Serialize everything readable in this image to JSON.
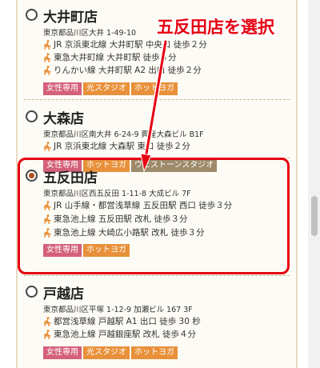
{
  "stores": [
    {
      "name": "大井町店",
      "address": "東京都品川区大井 1-49-10",
      "selected": false,
      "access": [
        "JR 京浜東北線 大井町駅 中央口 徒歩２分",
        "東急大井町線 大井町駅 徒歩４分",
        "りんかい線 大井町駅 A2 出口 徒歩２分"
      ],
      "tags": [
        {
          "label": "女性専用",
          "color": "pink"
        },
        {
          "label": "光スタジオ",
          "color": "orange"
        },
        {
          "label": "ホットヨガ",
          "color": "orange"
        }
      ]
    },
    {
      "name": "大森店",
      "address": "東京都品川区南大井 6-24-9 興産大森ビル B1F",
      "selected": false,
      "access": [
        "JR 京浜東北線 大森駅 東口 徒歩２分"
      ],
      "tags": [
        {
          "label": "女性専用",
          "color": "pink"
        },
        {
          "label": "ホットヨガ",
          "color": "orange"
        },
        {
          "label": "ウェストーンスタジオ",
          "color": "brown"
        }
      ]
    },
    {
      "name": "五反田店",
      "address": "東京都品川区西五反田 1-11-8 大成ビル 7F",
      "selected": true,
      "access": [
        "JR 山手線・都営浅草線 五反田駅 西口 徒歩３分",
        "東急池上線 五反田駅 改札 徒歩３分",
        "東急池上線 大崎広小路駅 改札 徒歩３分"
      ],
      "tags": [
        {
          "label": "女性専用",
          "color": "pink"
        },
        {
          "label": "ホットヨガ",
          "color": "orange"
        }
      ]
    },
    {
      "name": "戸越店",
      "address": "東京都品川区平塚 1-12-9 加瀬ビル 167 3F",
      "selected": false,
      "access": [
        "都営浅草線 戸越駅 A1 出口 徒歩 30 秒",
        "東急池上線 戸越銀座駅 改札 徒歩４分"
      ],
      "tags": [
        {
          "label": "女性専用",
          "color": "pink"
        },
        {
          "label": "光スタジオ",
          "color": "orange"
        },
        {
          "label": "ホットヨガ",
          "color": "orange"
        }
      ]
    }
  ],
  "annotation": {
    "text": "五反田店を選択",
    "color": "#e60012"
  },
  "colors": {
    "tag_pink": "#d4607a",
    "tag_orange": "#e8913a",
    "tag_brown": "#9d8a6a",
    "walk_icon": "#e8913a",
    "radio_selected": "#b84a1a"
  }
}
